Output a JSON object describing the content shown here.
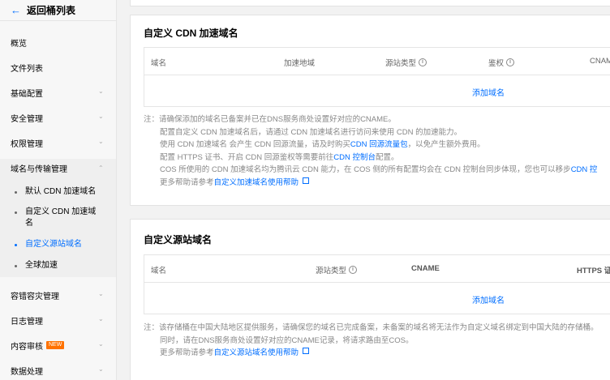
{
  "sidebar": {
    "back_label": "返回桶列表",
    "items": [
      {
        "label": "概览"
      },
      {
        "label": "文件列表"
      },
      {
        "label": "基础配置"
      },
      {
        "label": "安全管理"
      },
      {
        "label": "权限管理"
      },
      {
        "label": "域名与传输管理"
      },
      {
        "label": "容错容灾管理"
      },
      {
        "label": "日志管理"
      },
      {
        "label": "内容审核",
        "badge": "NEW"
      },
      {
        "label": "数据处理"
      }
    ],
    "subitems": [
      {
        "label": "默认 CDN 加速域名"
      },
      {
        "label": "自定义 CDN 加速域名"
      },
      {
        "label": "自定义源站域名"
      },
      {
        "label": "全球加速"
      }
    ]
  },
  "cdn_section": {
    "title": "自定义 CDN 加速域名",
    "columns": [
      "域名",
      "加速地域",
      "源站类型",
      "鉴权",
      "CNAME"
    ],
    "add_label": "添加域名",
    "notes": {
      "prefix": "注：",
      "line1": "请确保添加的域名已备案并已在DNS服务商处设置好对应的CNAME。",
      "line2": "配置自定义 CDN 加速域名后，请通过 CDN 加速域名进行访问来使用 CDN 的加速能力。",
      "line3_a": "使用 CDN 加速域名 会产生 CDN 回源流量，请及时购买 ",
      "line3_link": "CDN 回源流量包",
      "line3_b": "，以免产生额外费用。",
      "line4_a": "配置 HTTPS 证书、开启 CDN 回源鉴权等需要前往 ",
      "line4_link": "CDN 控制台",
      "line4_b": " 配置。",
      "line5_a": "COS 所使用的 CDN 加速域名均为腾讯云 CDN 能力，在 COS 侧的所有配置均会在 CDN 控制台同步体现，您也可以移步 ",
      "line5_link": "CDN 控",
      "line6_a": "更多帮助请参考 ",
      "line6_link": "自定义加速域名使用帮助"
    }
  },
  "origin_section": {
    "title": "自定义源站域名",
    "columns": [
      "域名",
      "源站类型",
      "CNAME",
      "HTTPS 证"
    ],
    "add_label": "添加域名",
    "notes": {
      "prefix": "注：",
      "line1": "该存储桶在中国大陆地区提供服务，请确保您的域名已完成备案，未备案的域名将无法作为自定义域名绑定到中国大陆的存储桶。",
      "line2": "同时，请在DNS服务商处设置好对应的CNAME记录，将请求路由至COS。",
      "line3_a": "更多帮助请参考 ",
      "line3_link": "自定义源站域名使用帮助"
    }
  },
  "colors": {
    "accent": "#006eff",
    "badge": "#ff7200"
  }
}
